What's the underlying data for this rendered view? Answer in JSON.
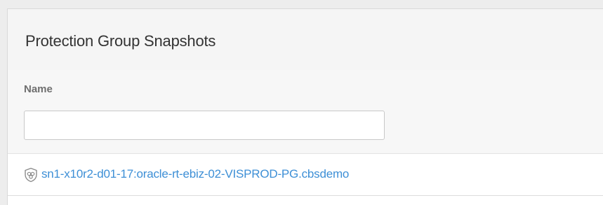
{
  "panel": {
    "title": "Protection Group Snapshots"
  },
  "filter": {
    "label": "Name",
    "value": "",
    "placeholder": ""
  },
  "rows": [
    {
      "icon": "protection-group-shield-icon",
      "name": "sn1-x10r2-d01-17:oracle-rt-ebiz-02-VISPROD-PG.cbsdemo"
    }
  ],
  "colors": {
    "link": "#3d8fd6",
    "title": "#333333",
    "label": "#6f6f6f",
    "header_bg": "#f5f5f5",
    "page_bg": "#ededed"
  }
}
